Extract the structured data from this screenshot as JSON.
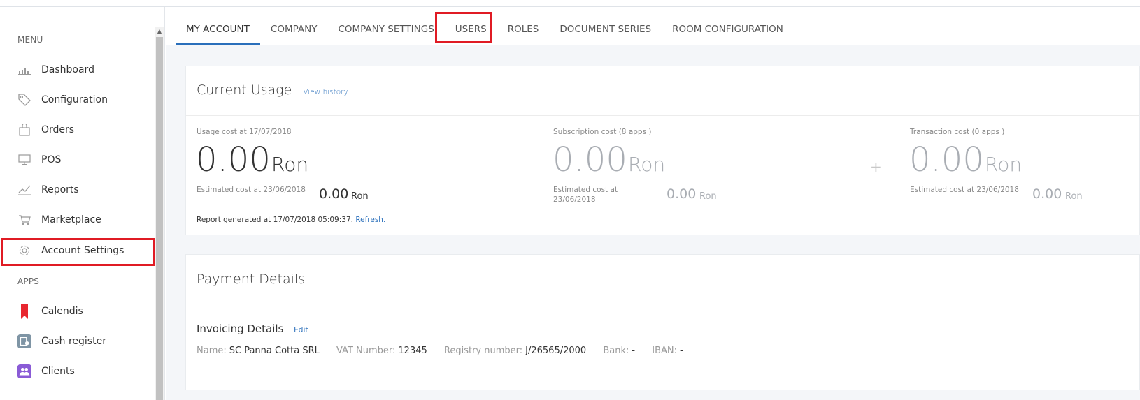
{
  "sidebar": {
    "menu_heading": "MENU",
    "apps_heading": "APPS",
    "menu_items": [
      {
        "label": "Dashboard",
        "icon": "bar-chart-icon"
      },
      {
        "label": "Configuration",
        "icon": "tag-icon"
      },
      {
        "label": "Orders",
        "icon": "shopping-bag-icon"
      },
      {
        "label": "POS",
        "icon": "monitor-icon"
      },
      {
        "label": "Reports",
        "icon": "line-chart-icon"
      },
      {
        "label": "Marketplace",
        "icon": "cart-icon"
      },
      {
        "label": "Account Settings",
        "icon": "gear-icon"
      }
    ],
    "app_items": [
      {
        "label": "Calendis",
        "icon": "bookmark-icon",
        "color": "#e8262f"
      },
      {
        "label": "Cash register",
        "icon": "cash-register-icon",
        "color": "#7f95a5"
      },
      {
        "label": "Clients",
        "icon": "users-icon",
        "color": "#8a5bd6"
      }
    ]
  },
  "tabs": [
    "MY ACCOUNT",
    "COMPANY",
    "COMPANY SETTINGS",
    "USERS",
    "ROLES",
    "DOCUMENT SERIES",
    "ROOM CONFIGURATION"
  ],
  "active_tab": "MY ACCOUNT",
  "usage": {
    "title": "Current Usage",
    "history_link": "View history",
    "total": {
      "label": "Usage cost at 17/07/2018",
      "amount": "0.00",
      "unit": "Ron",
      "est_label": "Estimated cost at 23/06/2018",
      "est_amount": "0.00",
      "est_unit": "Ron"
    },
    "subscription": {
      "label": "Subscription cost (8 apps )",
      "amount": "0.00",
      "unit": "Ron",
      "est_label_1": "Estimated cost at",
      "est_label_2": "23/06/2018",
      "est_amount": "0.00",
      "est_unit": "Ron"
    },
    "plus_sign": "+",
    "transaction": {
      "label": "Transaction cost (0 apps )",
      "amount": "0.00",
      "unit": "Ron",
      "est_label": "Estimated cost at 23/06/2018",
      "est_amount": "0.00",
      "est_unit": "Ron"
    },
    "report_text": "Report generated at 17/07/2018 05:09:37.",
    "refresh_link": "Refresh."
  },
  "payment": {
    "title": "Payment Details",
    "invoicing_title": "Invoicing Details",
    "edit_link": "Edit",
    "fields": {
      "name_key": "Name:",
      "name_val": "SC Panna Cotta SRL",
      "vat_key": "VAT Number:",
      "vat_val": "12345",
      "registry_key": "Registry number:",
      "registry_val": "J/26565/2000",
      "bank_key": "Bank:",
      "bank_val": "-",
      "iban_key": "IBAN:",
      "iban_val": "-"
    }
  },
  "colors": {
    "accent": "#2a6fbb",
    "highlight": "#e01b24"
  }
}
